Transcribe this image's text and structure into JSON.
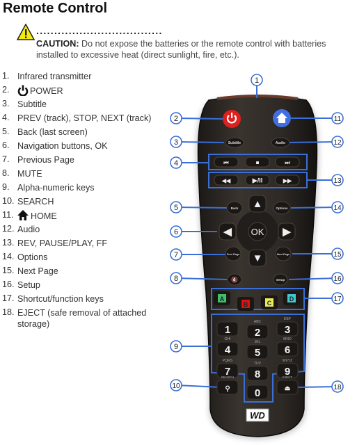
{
  "title": "Remote Control",
  "caution": {
    "dots": "...................................",
    "label": "CAUTION:",
    "text": " Do not expose the batteries or the remote control with batteries installed to excessive heat (direct sunlight, fire, etc.)."
  },
  "items": [
    {
      "n": "1.",
      "t": "Infrared transmitter"
    },
    {
      "n": "2.",
      "t": "POWER",
      "icon": "power-icon"
    },
    {
      "n": "3.",
      "t": "Subtitle"
    },
    {
      "n": "4.",
      "t": "PREV (track), STOP, NEXT (track)"
    },
    {
      "n": "5.",
      "t": "Back (last screen)"
    },
    {
      "n": "6.",
      "t": "Navigation buttons, OK"
    },
    {
      "n": "7.",
      "t": "Previous Page"
    },
    {
      "n": "8.",
      "t": "MUTE"
    },
    {
      "n": "9.",
      "t": "Alpha-numeric keys"
    },
    {
      "n": "10.",
      "t": "SEARCH"
    },
    {
      "n": "11.",
      "t": "HOME",
      "icon": "home-icon"
    },
    {
      "n": "12.",
      "t": "Audio"
    },
    {
      "n": "13.",
      "t": "REV, PAUSE/PLAY, FF"
    },
    {
      "n": "14.",
      "t": "Options"
    },
    {
      "n": "15.",
      "t": "Next Page"
    },
    {
      "n": "16.",
      "t": "Setup"
    },
    {
      "n": "17.",
      "t": "Shortcut/function keys"
    },
    {
      "n": "18.",
      "t": "EJECT (safe removal of attached storage)",
      "t1": "EJECT (safe removal of attached",
      "t2": "storage)"
    }
  ],
  "remote": {
    "buttons": {
      "subtitle": "Subtitle",
      "audio": "Audio",
      "back": "Back",
      "options": "Options",
      "prev_page": "Prev Page",
      "next_page": "Next Page",
      "setup": "Setup",
      "ok": "OK",
      "a": "A",
      "b": "B",
      "c": "C",
      "d": "D",
      "search": "SEARCH",
      "eject": "EJECT",
      "logo": "WD"
    },
    "keys": [
      {
        "d": "1",
        "l": ""
      },
      {
        "d": "2",
        "l": "ABC"
      },
      {
        "d": "3",
        "l": "DEF"
      },
      {
        "d": "4",
        "l": "GHI"
      },
      {
        "d": "5",
        "l": "JKL"
      },
      {
        "d": "6",
        "l": "MNO"
      },
      {
        "d": "7",
        "l": "PQRS"
      },
      {
        "d": "8",
        "l": "TUV"
      },
      {
        "d": "9",
        "l": "WXYZ"
      },
      {
        "d": "0",
        "l": ""
      }
    ],
    "callouts": [
      "1",
      "2",
      "3",
      "4",
      "5",
      "6",
      "7",
      "8",
      "9",
      "10",
      "11",
      "12",
      "13",
      "14",
      "15",
      "16",
      "17",
      "18"
    ]
  },
  "colors": {
    "callout": "#3a6fd8",
    "power": "#e0201c",
    "home": "#3f6fe0",
    "body": "#2b2622",
    "a": "#3fbf6a",
    "b": "#e01010",
    "c": "#e8e85a",
    "d": "#40c8d0"
  }
}
